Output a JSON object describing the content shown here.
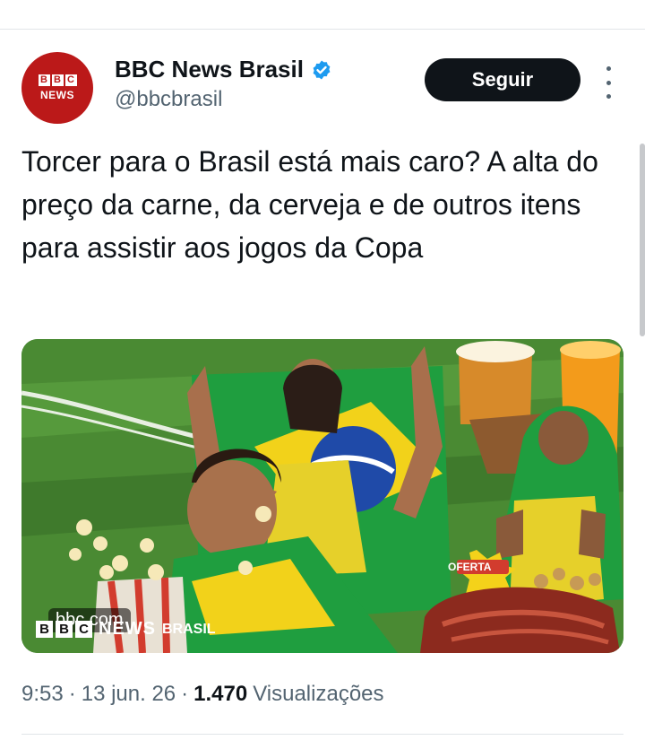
{
  "account": {
    "display_name": "BBC News Brasil",
    "handle": "@bbcbrasil",
    "verified_icon": "verified-badge-icon",
    "avatar": {
      "blocks": [
        "B",
        "B",
        "C"
      ],
      "news": "NEWS"
    }
  },
  "follow_button": {
    "label": "Seguir"
  },
  "tweet": {
    "text": "Torcer para o Brasil está mais caro? A alta do preço da carne, da cerveja e de outros itens para assistir aos jogos da Copa"
  },
  "media": {
    "domain": "bbc.com",
    "watermark_blocks": [
      "B",
      "B",
      "C"
    ],
    "watermark_news": "NEWS",
    "watermark_region": "BRASIL",
    "price_tag": "OFERTA"
  },
  "meta": {
    "time": "9:53",
    "separator": "·",
    "date": "13 jun. 26",
    "views_count": "1.470",
    "views_label": "Visualizações"
  },
  "colors": {
    "brand_red": "#bb1919",
    "verified_blue": "#1d9bf0",
    "button_dark": "#0f1419",
    "muted": "#536471"
  }
}
